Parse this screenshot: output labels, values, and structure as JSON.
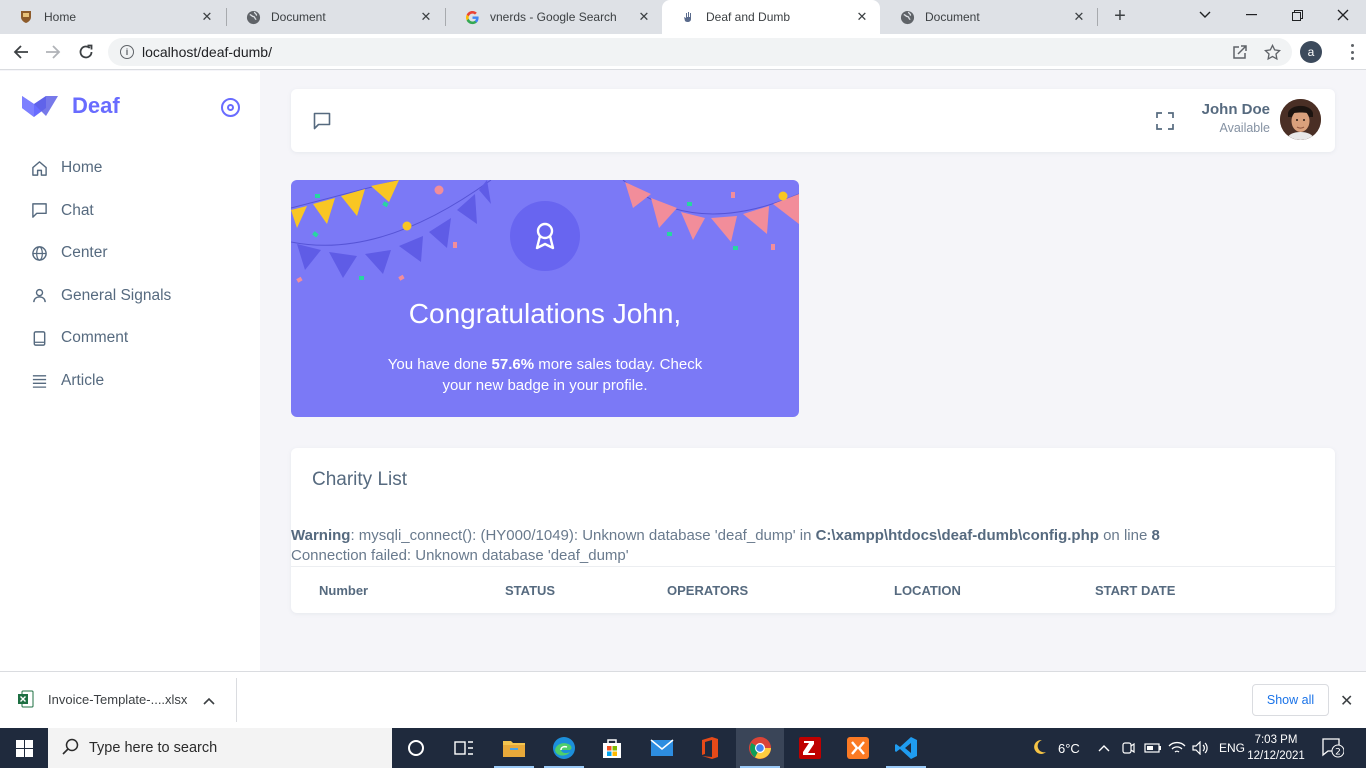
{
  "browser": {
    "tabs": [
      {
        "title": "Home",
        "favicon": "crest-icon"
      },
      {
        "title": "Document",
        "favicon": "globe-icon"
      },
      {
        "title": "vnerds - Google Search",
        "favicon": "google-icon"
      },
      {
        "title": "Deaf and Dumb",
        "favicon": "hand-icon"
      },
      {
        "title": "Document",
        "favicon": "globe-icon"
      }
    ],
    "active_tab": "Deaf and Dumb",
    "url": "localhost/deaf-dumb/",
    "profile_initial": "a"
  },
  "sidebar": {
    "brand": "Deaf",
    "items": [
      {
        "label": "Home",
        "icon": "home-icon"
      },
      {
        "label": "Chat",
        "icon": "chat-icon"
      },
      {
        "label": "Center",
        "icon": "globe-icon"
      },
      {
        "label": "General Signals",
        "icon": "user-icon"
      },
      {
        "label": "Comment",
        "icon": "book-icon"
      },
      {
        "label": "Article",
        "icon": "list-icon"
      }
    ]
  },
  "navbar": {
    "user_name": "John Doe",
    "user_status": "Available"
  },
  "congrats": {
    "title": "Congratulations John,",
    "text_before": "You have done ",
    "highlight": "57.6%",
    "text_after": " more sales today. Check your new badge in your profile."
  },
  "charity": {
    "title": "Charity List",
    "warning_label": "Warning",
    "warning_text": ": mysqli_connect(): (HY000/1049): Unknown database 'deaf_dump' in ",
    "warning_path": "C:\\xampp\\htdocs\\deaf-dumb\\config.php",
    "warning_on_line": " on line ",
    "warning_line": "8",
    "connection_failed": "Connection failed: Unknown database 'deaf_dump'",
    "columns": [
      "Number",
      "STATUS",
      "OPERATORS",
      "LOCATION",
      "START DATE"
    ]
  },
  "downloads": {
    "file_name": "Invoice-Template-....xlsx",
    "show_all": "Show all"
  },
  "taskbar": {
    "search_placeholder": "Type here to search",
    "temperature": "6°C",
    "language": "ENG",
    "time": "7:03 PM",
    "date": "12/12/2021",
    "notification_count": "2"
  },
  "colors": {
    "primary": "#696cff",
    "card": "#7b79f6",
    "text": "#566a7f"
  }
}
